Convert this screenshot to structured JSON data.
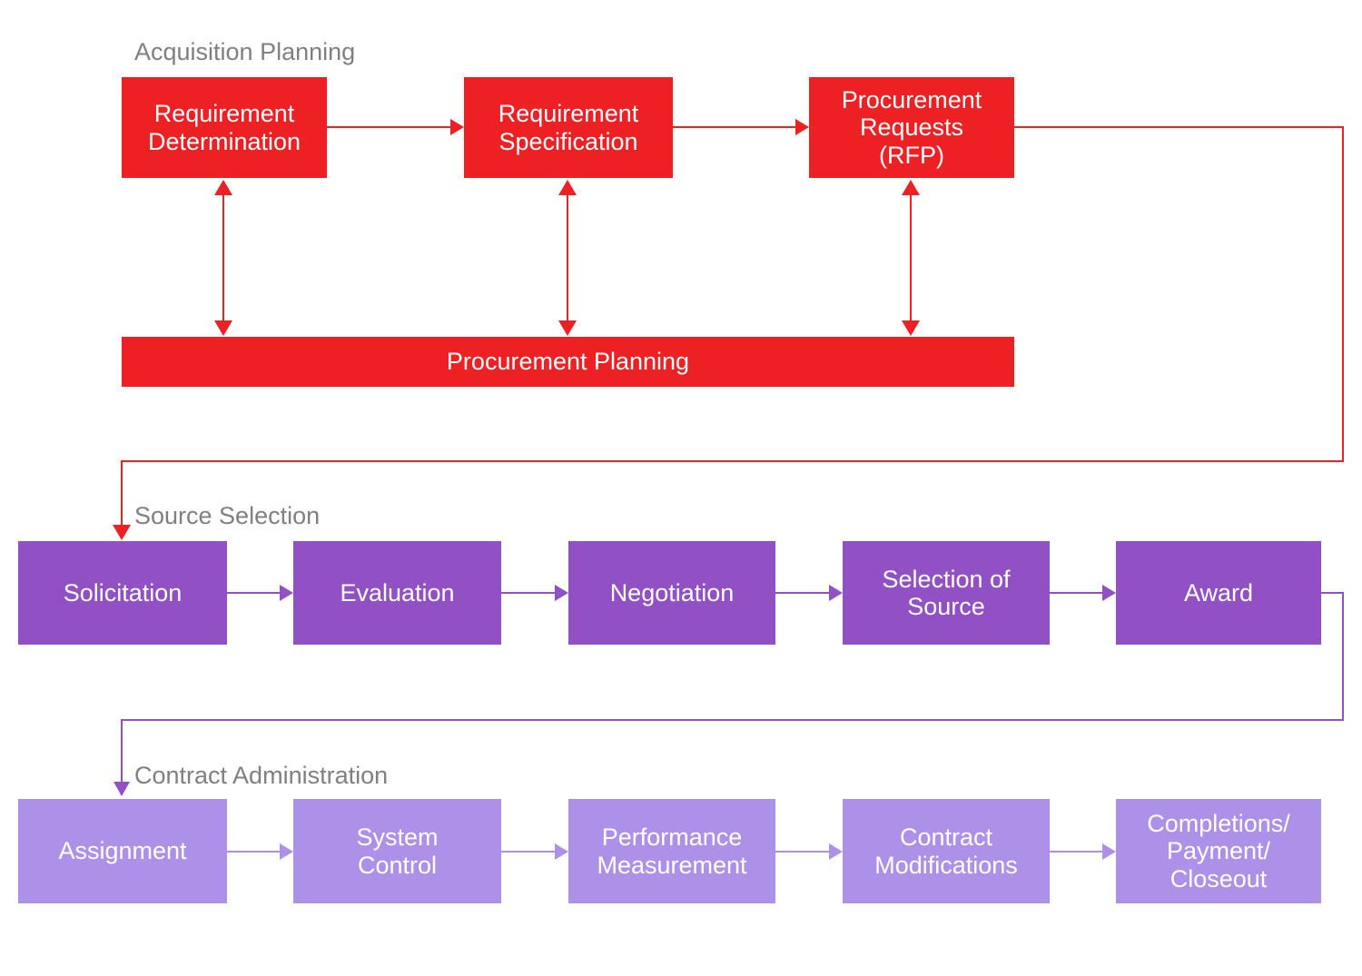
{
  "diagram": {
    "title_visible": false,
    "background": "#FFFFFF",
    "colors": {
      "red": "#ED2024",
      "purple": "#9150C4",
      "lavender": "#AD91E8",
      "label_gray": "#808080",
      "node_text": "#FFFFFF"
    }
  },
  "sections": [
    {
      "id": "acquisition-planning",
      "label": "Acquisition Planning"
    },
    {
      "id": "source-selection",
      "label": "Source Selection"
    },
    {
      "id": "contract-administration",
      "label": "Contract Administration"
    }
  ],
  "acquisition_planning": {
    "nodes": [
      {
        "id": "requirement-determination",
        "label": "Requirement\nDetermination"
      },
      {
        "id": "requirement-specification",
        "label": "Requirement\nSpecification"
      },
      {
        "id": "procurement-requests",
        "label": "Procurement\nRequests\n(RFP)"
      }
    ],
    "bar": {
      "id": "procurement-planning",
      "label": "Procurement Planning"
    }
  },
  "source_selection": {
    "nodes": [
      {
        "id": "solicitation",
        "label": "Solicitation"
      },
      {
        "id": "evaluation",
        "label": "Evaluation"
      },
      {
        "id": "negotiation",
        "label": "Negotiation"
      },
      {
        "id": "selection-of-source",
        "label": "Selection of\nSource"
      },
      {
        "id": "award",
        "label": "Award"
      }
    ]
  },
  "contract_administration": {
    "nodes": [
      {
        "id": "assignment",
        "label": "Assignment"
      },
      {
        "id": "system-control",
        "label": "System\nControl"
      },
      {
        "id": "performance-measurement",
        "label": "Performance\nMeasurement"
      },
      {
        "id": "contract-modifications",
        "label": "Contract\nModifications"
      },
      {
        "id": "completions-payment-closeout",
        "label": "Completions/\nPayment/\nCloseout"
      }
    ]
  },
  "connectors": [
    {
      "from": "requirement-determination",
      "to": "requirement-specification",
      "color": "#ED2024",
      "style": "arrow-right"
    },
    {
      "from": "requirement-specification",
      "to": "procurement-requests",
      "color": "#ED2024",
      "style": "arrow-right"
    },
    {
      "from": "requirement-determination",
      "to": "procurement-planning",
      "color": "#ED2024",
      "style": "double-vertical"
    },
    {
      "from": "requirement-specification",
      "to": "procurement-planning",
      "color": "#ED2024",
      "style": "double-vertical"
    },
    {
      "from": "procurement-requests",
      "to": "procurement-planning",
      "color": "#ED2024",
      "style": "double-vertical"
    },
    {
      "from": "procurement-requests",
      "to": "solicitation",
      "color": "#ED2024",
      "style": "elbow-right-down-left-down"
    },
    {
      "from": "solicitation",
      "to": "evaluation",
      "color": "#9150C4",
      "style": "arrow-right"
    },
    {
      "from": "evaluation",
      "to": "negotiation",
      "color": "#9150C4",
      "style": "arrow-right"
    },
    {
      "from": "negotiation",
      "to": "selection-of-source",
      "color": "#9150C4",
      "style": "arrow-right"
    },
    {
      "from": "selection-of-source",
      "to": "award",
      "color": "#9150C4",
      "style": "arrow-right"
    },
    {
      "from": "award",
      "to": "assignment",
      "color": "#9150C4",
      "style": "elbow-right-down-left-down"
    },
    {
      "from": "assignment",
      "to": "system-control",
      "color": "#AD91E8",
      "style": "arrow-right"
    },
    {
      "from": "system-control",
      "to": "performance-measurement",
      "color": "#AD91E8",
      "style": "arrow-right"
    },
    {
      "from": "performance-measurement",
      "to": "contract-modifications",
      "color": "#AD91E8",
      "style": "arrow-right"
    },
    {
      "from": "contract-modifications",
      "to": "completions-payment-closeout",
      "color": "#AD91E8",
      "style": "arrow-right"
    }
  ]
}
